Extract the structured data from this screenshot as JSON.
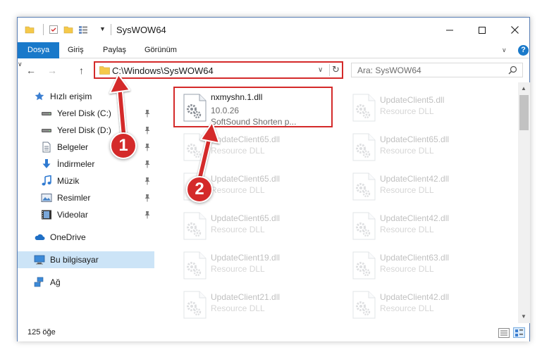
{
  "window": {
    "title": "SysWOW64"
  },
  "ribbon": {
    "tabs": [
      {
        "label": "Dosya"
      },
      {
        "label": "Giriş"
      },
      {
        "label": "Paylaş"
      },
      {
        "label": "Görünüm"
      }
    ]
  },
  "nav": {
    "address": "C:\\Windows\\SysWOW64",
    "search_placeholder": "Ara: SysWOW64"
  },
  "sidebar": {
    "items": [
      {
        "label": "Hızlı erişim",
        "icon": "star-icon"
      },
      {
        "label": "Yerel Disk (C:)",
        "icon": "drive-icon"
      },
      {
        "label": "Yerel Disk (D:)",
        "icon": "drive-icon"
      },
      {
        "label": "Belgeler",
        "icon": "documents-icon"
      },
      {
        "label": "İndirmeler",
        "icon": "download-icon"
      },
      {
        "label": "Müzik",
        "icon": "music-icon"
      },
      {
        "label": "Resimler",
        "icon": "pictures-icon"
      },
      {
        "label": "Videolar",
        "icon": "videos-icon"
      },
      {
        "label": "OneDrive",
        "icon": "cloud-icon"
      },
      {
        "label": "Bu bilgisayar",
        "icon": "computer-icon"
      },
      {
        "label": "Ağ",
        "icon": "network-icon"
      }
    ]
  },
  "files": [
    {
      "name": "nxmyshn.1.dll",
      "version": "10.0.26",
      "description": "SoftSound Shorten p..."
    },
    {
      "name": "UpdateClient5.dll",
      "type": "Resource DLL"
    },
    {
      "name": "UpdateClient65.dll",
      "type": "Resource DLL"
    },
    {
      "name": "UpdateClient65.dll",
      "type": "Resource DLL"
    },
    {
      "name": "UpdateClient65.dll",
      "type": "Resource DLL"
    },
    {
      "name": "UpdateClient42.dll",
      "type": "Resource DLL"
    },
    {
      "name": "UpdateClient65.dll",
      "type": "Resource DLL"
    },
    {
      "name": "UpdateClient42.dll",
      "type": "Resource DLL"
    },
    {
      "name": "UpdateClient19.dll",
      "type": "Resource DLL"
    },
    {
      "name": "UpdateClient63.dll",
      "type": "Resource DLL"
    },
    {
      "name": "UpdateClient21.dll",
      "type": "Resource DLL"
    },
    {
      "name": "UpdateClient42.dll",
      "type": "Resource DLL"
    }
  ],
  "status": {
    "count": "125 öğe"
  },
  "annotations": {
    "step1": "1",
    "step2": "2"
  },
  "colors": {
    "accent": "#1979ca",
    "highlight": "#d42a2a",
    "selected": "#cce4f7"
  }
}
